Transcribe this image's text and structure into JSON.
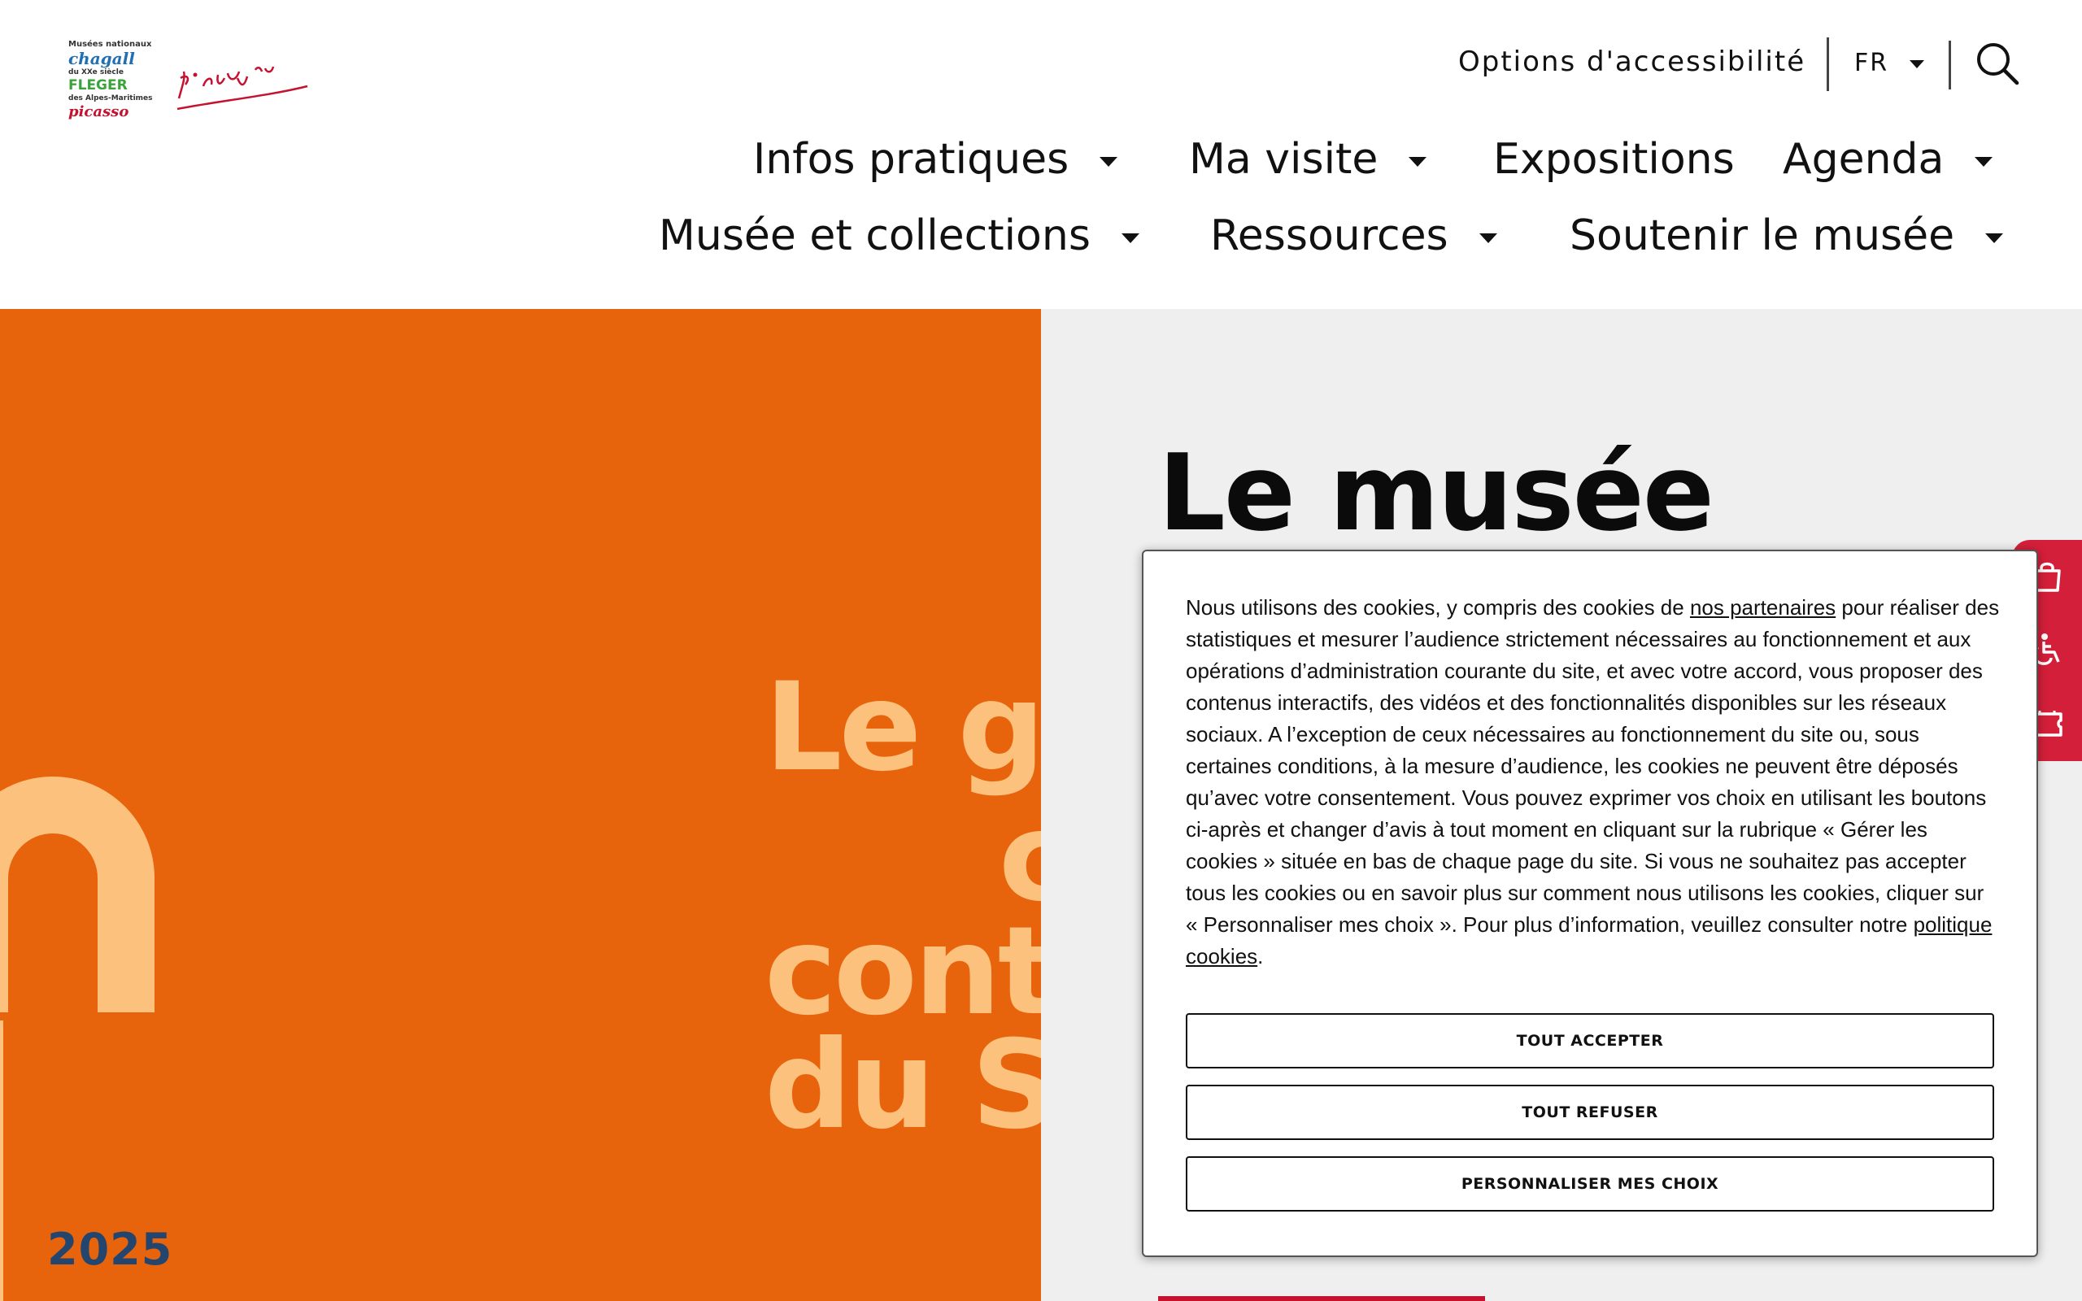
{
  "logo": {
    "line1": "Musées nationaux",
    "line2": "chagall",
    "line3": "du XXe siècle",
    "line4": "FLEGER",
    "line5": "des Alpes-Maritimes",
    "line6": "picasso"
  },
  "utility": {
    "accessibility_label": "Options d'accessibilité",
    "language": "FR"
  },
  "nav": {
    "row1": [
      {
        "label": "Infos pratiques",
        "has_dropdown": true
      },
      {
        "label": "Ma visite",
        "has_dropdown": true
      },
      {
        "label": "Expositions",
        "has_dropdown": false
      },
      {
        "label": "Agenda",
        "has_dropdown": true
      }
    ],
    "row2": [
      {
        "label": "Musée et collections",
        "has_dropdown": true
      },
      {
        "label": "Ressources",
        "has_dropdown": true
      },
      {
        "label": "Soutenir le musée",
        "has_dropdown": true
      }
    ]
  },
  "hero": {
    "title": "Le musée",
    "poster_lines": [
      "Le g",
      "c",
      "cont",
      "du S"
    ],
    "poster_year": "2025",
    "colors": {
      "poster_bg": "#e8640c",
      "poster_text": "#fdc17e",
      "accent": "#c4122f"
    }
  },
  "side_tools": [
    {
      "icon": "shopping-bag-icon",
      "label": "Boutique"
    },
    {
      "icon": "accessibility-icon",
      "label": "Accessibilité"
    },
    {
      "icon": "ticket-icon",
      "label": "Billetterie"
    }
  ],
  "cookie": {
    "text_before_link": "Nous utilisons des cookies, y compris des cookies de ",
    "partners_link": "nos partenaires",
    "text_middle": " pour réaliser des statistiques et mesurer l’audience strictement nécessaires au fonctionnement et aux opérations d’administration courante du site, et avec votre accord, vous proposer des contenus interactifs, des vidéos et des fonctionnalités disponibles sur les réseaux sociaux. A l’exception de ceux nécessaires au fonctionnement du site ou, sous certaines conditions, à la mesure d’audience, les cookies ne peuvent être déposés qu’avec votre consentement. Vous pouvez exprimer vos choix en utilisant les boutons ci-après et changer d’avis à tout moment en cliquant sur la rubrique « Gérer les cookies » située en bas de chaque page du site. Si vous ne souhaitez pas accepter tous les cookies ou en savoir plus sur comment nous utilisons les cookies, cliquer sur « Personnaliser mes choix ». Pour plus d’information, veuillez consulter notre ",
    "policy_link": "politique cookies",
    "text_end": ".",
    "accept_label": "TOUT ACCEPTER",
    "refuse_label": "TOUT REFUSER",
    "customize_label": "PERSONNALISER MES CHOIX"
  }
}
